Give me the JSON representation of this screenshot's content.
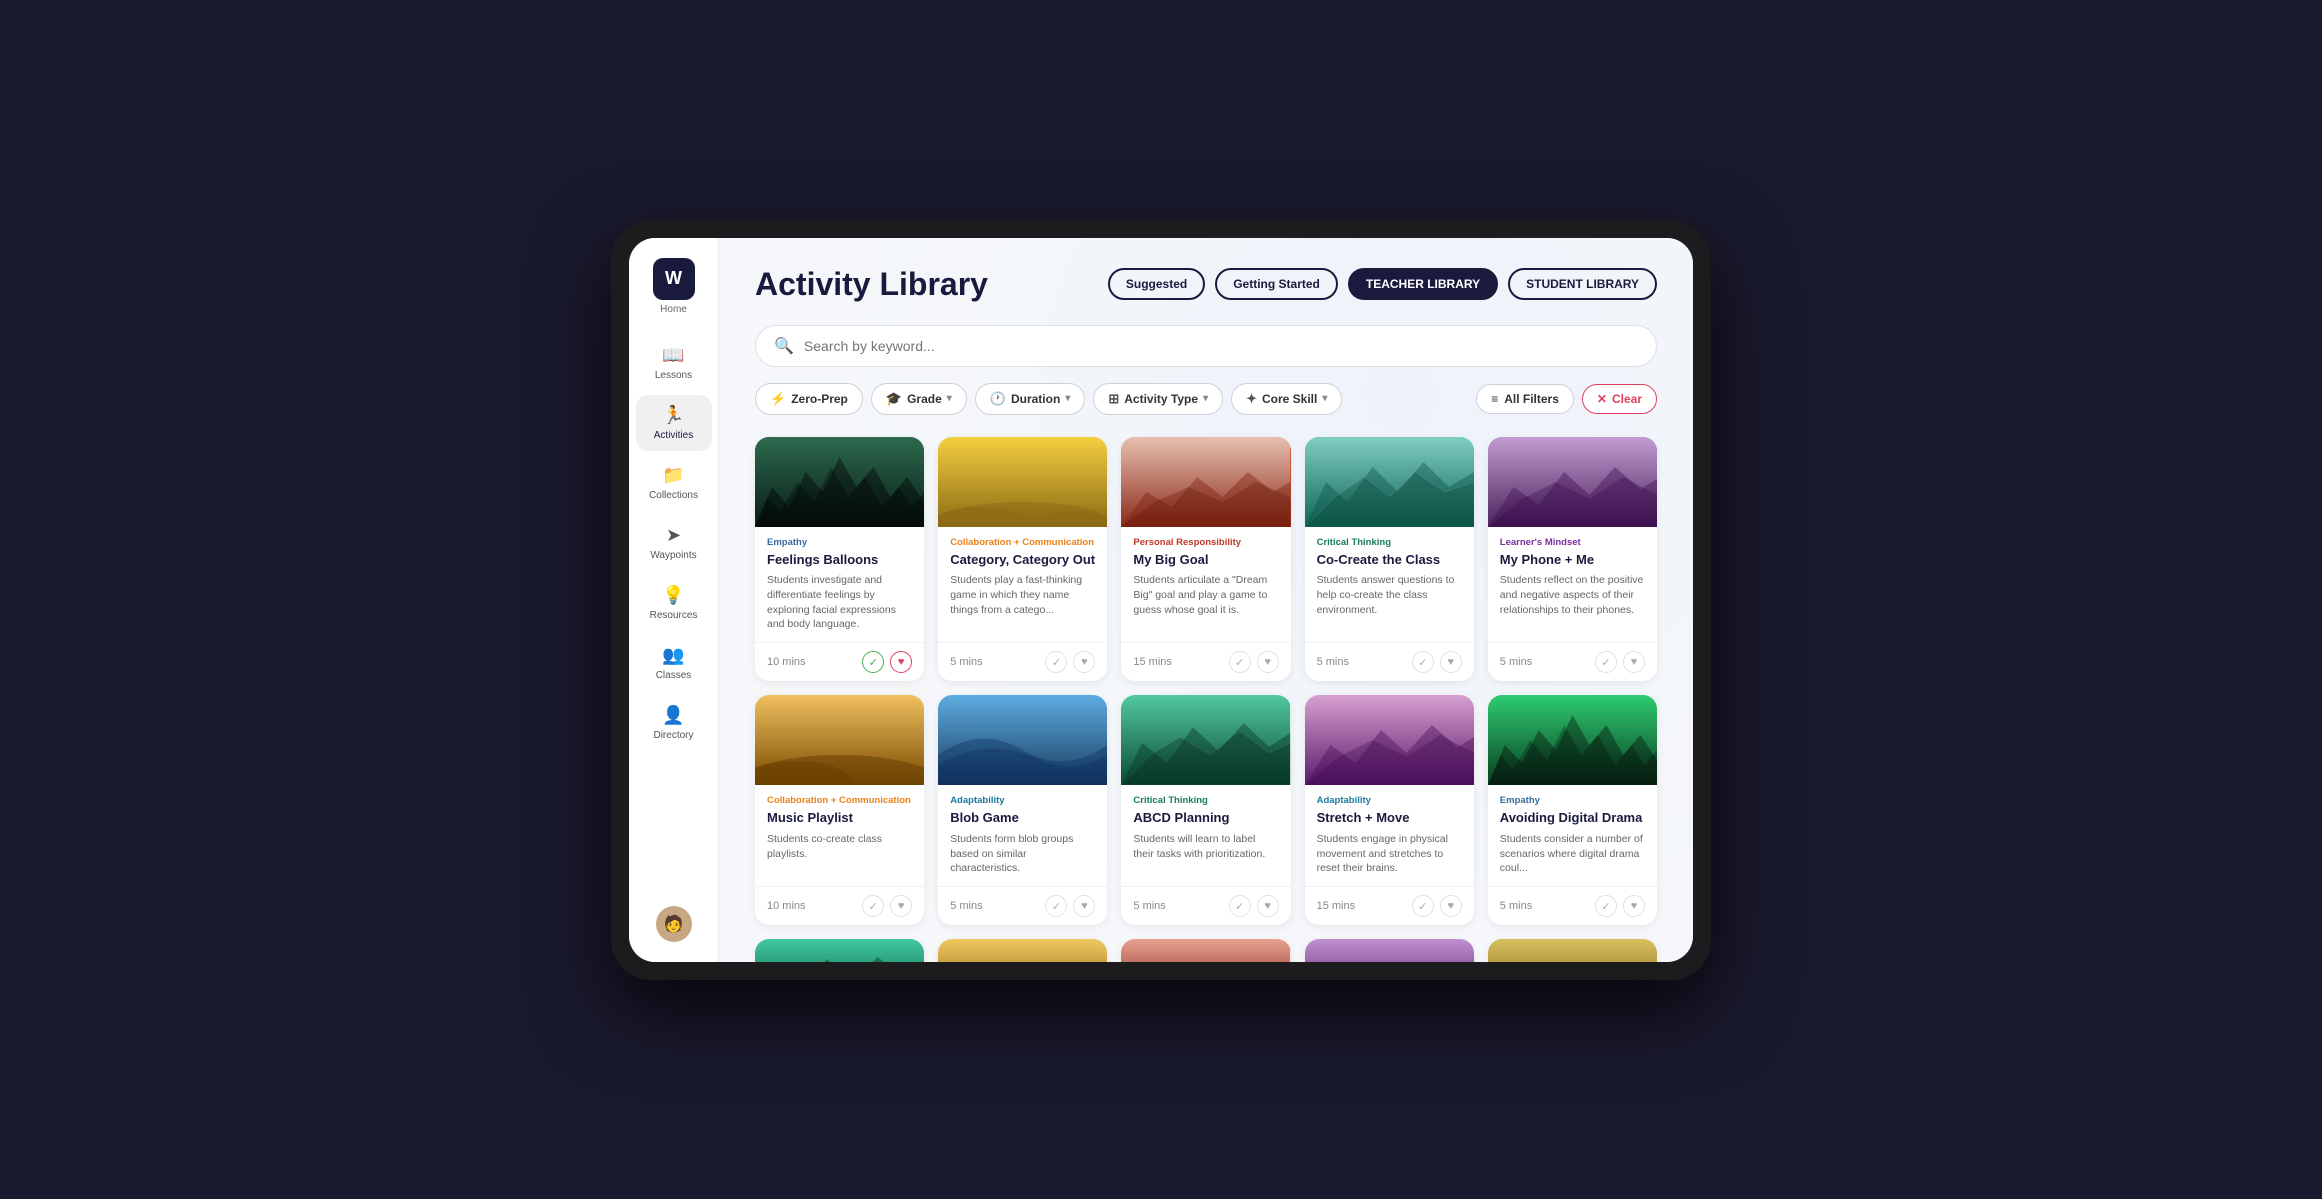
{
  "page": {
    "title": "Activity Library"
  },
  "header": {
    "tabs": [
      {
        "id": "suggested",
        "label": "Suggested",
        "active": true
      },
      {
        "id": "getting-started",
        "label": "Getting Started",
        "active": false
      },
      {
        "id": "teacher-library",
        "label": "TEACHER LIBRARY",
        "active": true,
        "style": "filled"
      },
      {
        "id": "student-library",
        "label": "STUDENT LIBRARY",
        "active": false
      }
    ]
  },
  "search": {
    "placeholder": "Search by keyword..."
  },
  "filters": {
    "zero_prep": "Zero-Prep",
    "grade": "Grade",
    "duration": "Duration",
    "activity_type": "Activity Type",
    "core_skill": "Core Skill",
    "all_filters": "All Filters",
    "clear": "Clear"
  },
  "sidebar": {
    "logo": "W",
    "home_label": "Home",
    "items": [
      {
        "id": "lessons",
        "label": "Lessons",
        "icon": "📖"
      },
      {
        "id": "activities",
        "label": "Activities",
        "icon": "🏃"
      },
      {
        "id": "collections",
        "label": "Collections",
        "icon": "📁"
      },
      {
        "id": "waypoints",
        "label": "Waypoints",
        "icon": "➤"
      },
      {
        "id": "resources",
        "label": "Resources",
        "icon": "💡"
      },
      {
        "id": "classes",
        "label": "Classes",
        "icon": "👥"
      },
      {
        "id": "directory",
        "label": "Directory",
        "icon": "👤"
      }
    ]
  },
  "cards_row1": [
    {
      "id": "feelings-balloons",
      "category": "Empathy",
      "category_class": "cat-empathy",
      "title": "Feelings Balloons",
      "desc": "Students investigate and differentiate feelings by exploring facial expressions and body language.",
      "time": "10 mins",
      "image_class": "img-green-forest",
      "checked": true,
      "hearted": true
    },
    {
      "id": "category-out",
      "category": "Collaboration + Communication",
      "category_class": "cat-collab",
      "title": "Category, Category Out",
      "desc": "Students play a fast-thinking game in which they name things from a catego...",
      "time": "5 mins",
      "image_class": "img-golden-field",
      "checked": false,
      "hearted": false
    },
    {
      "id": "my-big-goal",
      "category": "Personal Responsibility",
      "category_class": "cat-personal",
      "title": "My Big Goal",
      "desc": "Students articulate a \"Dream Big\" goal and play a game to guess whose goal it is.",
      "time": "15 mins",
      "image_class": "img-red-desert",
      "checked": false,
      "hearted": false
    },
    {
      "id": "co-create-class",
      "category": "Critical Thinking",
      "category_class": "cat-critical",
      "title": "Co-Create the Class",
      "desc": "Students answer questions to help co-create the class environment.",
      "time": "5 mins",
      "image_class": "img-teal-mountain",
      "checked": false,
      "hearted": false
    },
    {
      "id": "my-phone-me",
      "category": "Learner's Mindset",
      "category_class": "cat-learners",
      "title": "My Phone + Me",
      "desc": "Students reflect on the positive and negative aspects of their relationships to their phones.",
      "time": "5 mins",
      "image_class": "img-purple-mountain",
      "checked": false,
      "hearted": false
    }
  ],
  "cards_row2": [
    {
      "id": "music-playlist",
      "category": "Collaboration + Communication",
      "category_class": "cat-collab",
      "title": "Music Playlist",
      "desc": "Students co-create class playlists.",
      "time": "10 mins",
      "image_class": "img-orange-field",
      "checked": false,
      "hearted": false
    },
    {
      "id": "blob-game",
      "category": "Adaptability",
      "category_class": "cat-adaptability",
      "title": "Blob Game",
      "desc": "Students form blob groups based on similar characteristics.",
      "time": "5 mins",
      "image_class": "img-blue-wave",
      "checked": false,
      "hearted": false
    },
    {
      "id": "abcd-planning",
      "category": "Critical Thinking",
      "category_class": "cat-critical",
      "title": "ABCD Planning",
      "desc": "Students will learn to label their tasks with prioritization.",
      "time": "5 mins",
      "image_class": "img-dark-teal",
      "checked": false,
      "hearted": false
    },
    {
      "id": "stretch-move",
      "category": "Adaptability",
      "category_class": "cat-adaptability",
      "title": "Stretch + Move",
      "desc": "Students engage in physical movement and stretches to reset their brains.",
      "time": "15 mins",
      "image_class": "img-mauve",
      "checked": false,
      "hearted": false
    },
    {
      "id": "avoiding-digital-drama",
      "category": "Empathy",
      "category_class": "cat-empathy",
      "title": "Avoiding Digital Drama",
      "desc": "Students consider a number of scenarios where digital drama coul...",
      "time": "5 mins",
      "image_class": "img-dark-green",
      "checked": false,
      "hearted": false
    }
  ]
}
